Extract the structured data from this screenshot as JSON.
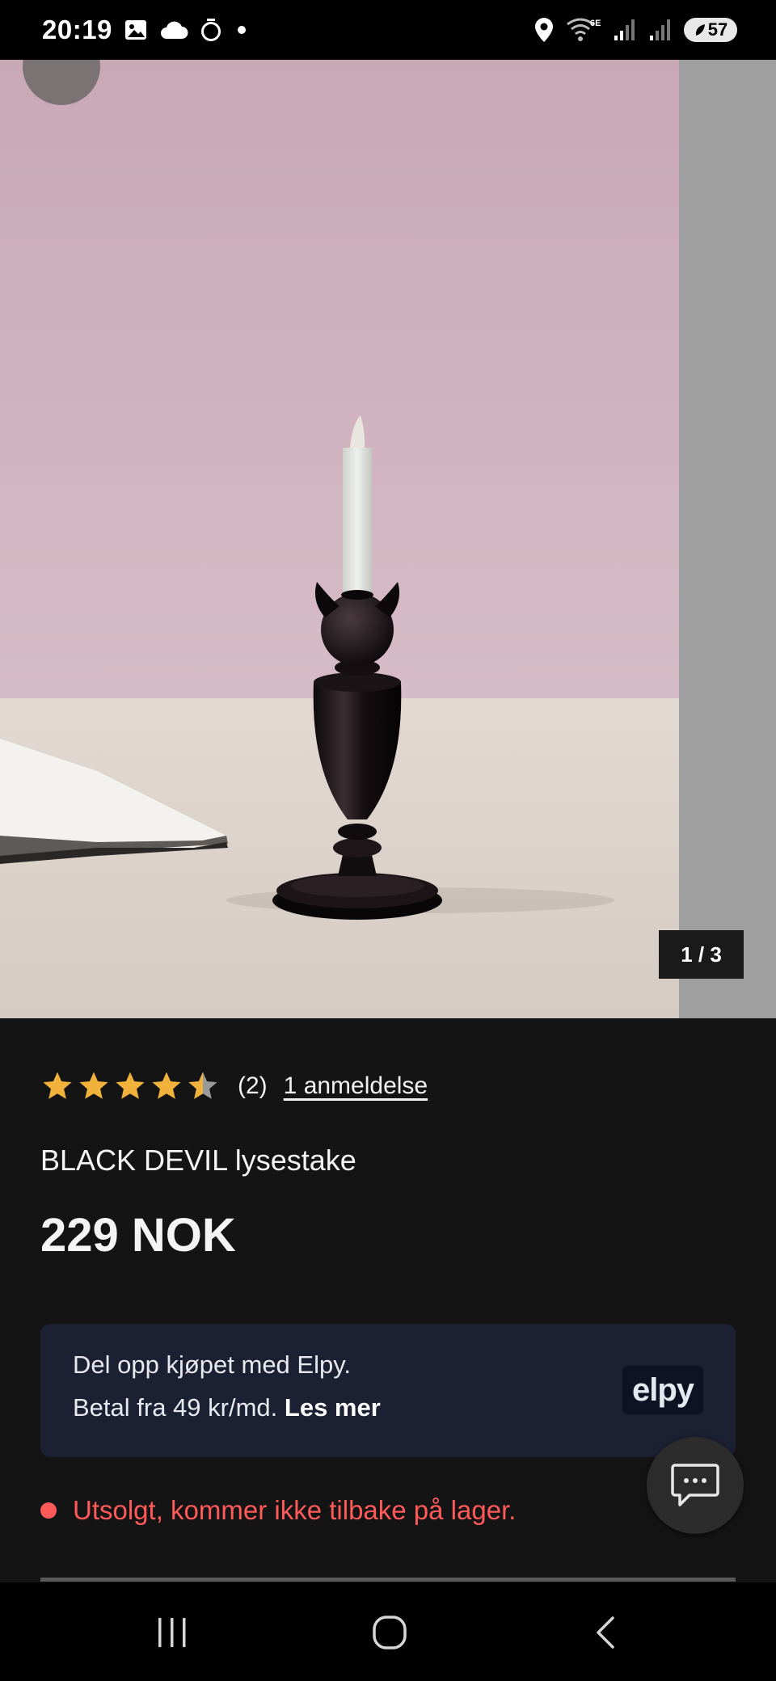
{
  "status_bar": {
    "time": "20:19",
    "battery": "57",
    "icons": [
      "gallery-icon",
      "cloud-icon",
      "timer-icon",
      "dot-icon",
      "location-icon",
      "wifi-6e-icon",
      "signal-icon",
      "signal-icon-2"
    ]
  },
  "gallery": {
    "counter": "1 / 3",
    "current": 1,
    "total": 3
  },
  "product": {
    "rating": 4.5,
    "rating_max": 5,
    "review_count": "(2)",
    "review_link": "1 anmeldelse",
    "name": "BLACK DEVIL lysestake",
    "price": "229 NOK"
  },
  "elpy": {
    "line1": "Del opp kjøpet med Elpy.",
    "line2_prefix": "Betal fra 49 kr/md.",
    "read_more": "Les mer",
    "logo_text": "elpy"
  },
  "stock": {
    "status": "Utsolgt, kommer ikke tilbake på lager.",
    "color": "#ff5a5a"
  },
  "colors": {
    "background": "#141414",
    "star": "#f0b23a",
    "star_empty": "#9a9a9a"
  }
}
